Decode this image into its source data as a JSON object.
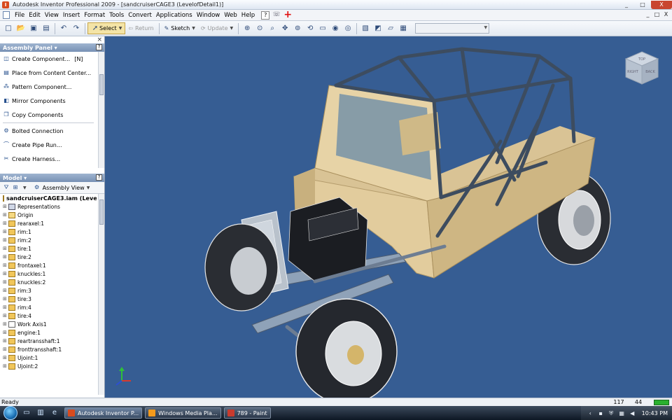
{
  "window": {
    "title": "Autodesk Inventor Professional 2009 - [sandcruiserCAGE3 (LevelofDetail1)]",
    "buttons": [
      "_",
      "□",
      "X"
    ]
  },
  "menu": {
    "items": [
      "File",
      "Edit",
      "View",
      "Insert",
      "Format",
      "Tools",
      "Convert",
      "Applications",
      "Window",
      "Web",
      "Help"
    ],
    "mdi_buttons": [
      "_",
      "□",
      "X"
    ]
  },
  "toolbar": {
    "select_label": "Select",
    "return_label": "Return",
    "sketch_label": "Sketch",
    "update_label": "Update",
    "combo_value": ""
  },
  "assembly_panel": {
    "title": "Assembly Panel ▾",
    "commands": [
      {
        "label": "Create Component...",
        "shortcut": "[N]",
        "icon": "create-component-icon"
      },
      {
        "label": "Place from Content Center...",
        "icon": "content-center-icon"
      },
      {
        "label": "Pattern Component...",
        "icon": "pattern-icon"
      },
      {
        "label": "Mirror Components",
        "icon": "mirror-icon"
      },
      {
        "label": "Copy Components",
        "icon": "copy-icon"
      },
      {
        "label": "Bolted Connection",
        "icon": "bolt-icon"
      },
      {
        "label": "Create Pipe Run...",
        "icon": "pipe-icon"
      },
      {
        "label": "Create Harness...",
        "icon": "harness-icon"
      }
    ]
  },
  "model_panel": {
    "title": "Model ▾",
    "view_label": "Assembly View",
    "tree": {
      "root": "sandcruiserCAGE3.iam (Levelof",
      "items": [
        {
          "label": "Representations",
          "type": "rep"
        },
        {
          "label": "Origin",
          "type": "folder"
        },
        {
          "label": "rearaxel:1",
          "type": "part"
        },
        {
          "label": "rim:1",
          "type": "part"
        },
        {
          "label": "rim:2",
          "type": "part"
        },
        {
          "label": "tire:1",
          "type": "part"
        },
        {
          "label": "tire:2",
          "type": "part"
        },
        {
          "label": "frontaxel:1",
          "type": "part"
        },
        {
          "label": "knuckles:1",
          "type": "part"
        },
        {
          "label": "knuckles:2",
          "type": "part"
        },
        {
          "label": "rim:3",
          "type": "part"
        },
        {
          "label": "tire:3",
          "type": "part"
        },
        {
          "label": "rim:4",
          "type": "part"
        },
        {
          "label": "tire:4",
          "type": "part"
        },
        {
          "label": "Work Axis1",
          "type": "work"
        },
        {
          "label": "engine:1",
          "type": "part"
        },
        {
          "label": "reartransshaft:1",
          "type": "part"
        },
        {
          "label": "fronttransshaft:1",
          "type": "part"
        },
        {
          "label": "Ujoint:1",
          "type": "part"
        },
        {
          "label": "Ujoint:2",
          "type": "part"
        }
      ]
    }
  },
  "viewcube": {
    "top_label": "TOP",
    "front_label": "RIGHT",
    "back_label": "BACK"
  },
  "status": {
    "text": "Ready",
    "value1": "117",
    "value2": "44"
  },
  "taskbar": {
    "tasks": [
      {
        "label": "Autodesk Inventor P...",
        "color": "#d84b1f"
      },
      {
        "label": "Windows Media Pla...",
        "color": "#f39a1c"
      },
      {
        "label": "789 - Paint",
        "color": "#c83b2e"
      }
    ],
    "clock": "10:43 PM"
  },
  "colors": {
    "viewport_bg": "#365d93",
    "body_tan": "#e2cc9d",
    "cage": "#3d4c5f",
    "frame": "#8fa2b8"
  }
}
